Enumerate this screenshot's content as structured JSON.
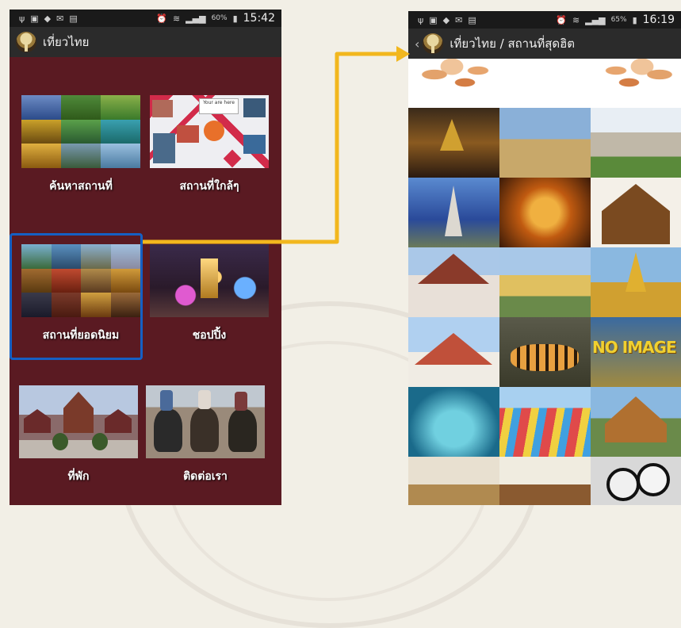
{
  "left_screen": {
    "status": {
      "battery": "60%",
      "time": "15:42"
    },
    "app_title": "เที่ยวไทย",
    "tiles": [
      {
        "label": "ค้นหาสถานที่"
      },
      {
        "label": "สถานที่ใกล้ๆ"
      },
      {
        "label": "สถานที่ยอดนิยม"
      },
      {
        "label": "ชอปปิ้ง"
      },
      {
        "label": "ที่พัก"
      },
      {
        "label": "ติดต่อเรา"
      }
    ],
    "map_callouts": {
      "you_are_here": "Your are here"
    }
  },
  "right_screen": {
    "status": {
      "battery": "65%",
      "time": "16:19"
    },
    "app_title": "เที่ยวไทย / สถานที่สุดฮิต",
    "no_image_text": "NO IMAGE"
  },
  "colors": {
    "left_background": "#5a1a22",
    "highlight_border": "#1560c4",
    "connector_arrow": "#f2b71e"
  },
  "icons": [
    "usb-icon",
    "gallery-icon",
    "app-icon",
    "mail-icon",
    "clipboard-icon",
    "alarm-icon",
    "wifi-icon",
    "signal-icon",
    "battery-icon",
    "back-chevron-icon"
  ]
}
